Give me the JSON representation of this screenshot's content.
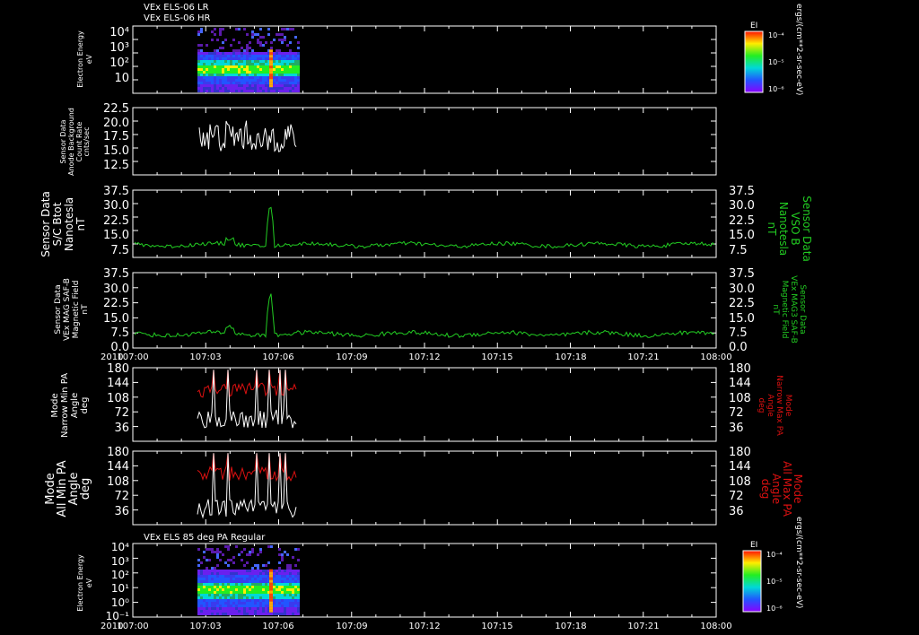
{
  "header": {
    "title_lr": "VEx ELS-06 LR",
    "title_hr": "VEx ELS-06 HR",
    "panel7_title": "VEx ELS 85 deg PA Regular",
    "year": "2010"
  },
  "colors": {
    "background": "#000000",
    "axis": "#ffffff",
    "trace_white": "#ffffff",
    "trace_green": "#22cc22",
    "trace_red": "#dd1111",
    "label_green": "#22cc22",
    "label_red": "#dd1111"
  },
  "time_axis": {
    "labels": [
      "107:00",
      "107:03",
      "107:06",
      "107:09",
      "107:12",
      "107:15",
      "107:18",
      "107:21",
      "108:00"
    ]
  },
  "colorbar": {
    "title": "EI",
    "units": "ergs/(cm**2-sr-sec-eV)",
    "ticks": [
      "10⁻⁴",
      "10⁻⁵",
      "10⁻⁶"
    ]
  },
  "chart_data": [
    {
      "type": "heatmap",
      "id": "p1",
      "ylabel": [
        "Electron Energy",
        "eV"
      ],
      "yticks": [
        "10⁴",
        "10³",
        "10²",
        "10"
      ],
      "coverage": [
        "107:02.5",
        "107:06.2"
      ]
    },
    {
      "type": "line",
      "id": "p2",
      "ylabel": [
        "Sensor Data",
        "Anode Background",
        "Count Rate",
        "cnts/sec"
      ],
      "ylim": [
        10,
        22.5
      ],
      "yticks": [
        "22.5",
        "20.0",
        "17.5",
        "15.0",
        "12.5"
      ],
      "series": [
        {
          "color": "#ffffff",
          "x": [
            107.0417,
            107.1033
          ],
          "y": [
            17.8,
            16.5
          ]
        }
      ]
    },
    {
      "type": "line",
      "id": "p3",
      "ylabel": [
        "Sensor Data",
        "S/C Btot",
        "Nanotesla",
        "nT"
      ],
      "ylabel_right": [
        "Sensor Data",
        "VSO B",
        "Nanotesla",
        "nT"
      ],
      "ylim": [
        0,
        37.5
      ],
      "yticks": [
        "37.5",
        "30.0",
        "22.5",
        "15.0",
        "7.5"
      ],
      "series": [
        {
          "color": "#22cc22",
          "baseline": 7.5,
          "spike_at": 107.0875,
          "spike_peak": 31.5
        }
      ]
    },
    {
      "type": "line",
      "id": "p4",
      "ylabel": [
        "Sensor Data",
        "VEx MAG SAF-B",
        "Magnetic Field",
        "nT"
      ],
      "ylabel_right": [
        "Sensor Data",
        "VEx MAG3 SAF-B",
        "Magnetic Field",
        "nT"
      ],
      "ylim": [
        0,
        37.5
      ],
      "yticks": [
        "37.5",
        "30.0",
        "22.5",
        "15.0",
        "7.5",
        "0.0"
      ],
      "series": [
        {
          "color": "#22cc22",
          "baseline": 7.5,
          "spike_at": 107.0875,
          "spike_peak": 30
        }
      ]
    },
    {
      "type": "line",
      "id": "p5",
      "ylabel": [
        "Mode",
        "Narrow Min PA",
        "Angle",
        "deg"
      ],
      "ylabel_right": [
        "Mode",
        "Narrow Max PA",
        "Angle",
        "deg"
      ],
      "ylim": [
        0,
        180
      ],
      "yticks": [
        "180",
        "144",
        "108",
        "72",
        "36"
      ],
      "series": [
        {
          "name": "min",
          "color": "#ffffff",
          "mean": 55
        },
        {
          "name": "max",
          "color": "#dd1111",
          "mean": 125
        }
      ]
    },
    {
      "type": "line",
      "id": "p6",
      "ylabel": [
        "Mode",
        "All Min PA",
        "Angle",
        "deg"
      ],
      "ylabel_right": [
        "Mode",
        "All Max PA",
        "Angle",
        "deg"
      ],
      "ylim": [
        0,
        180
      ],
      "yticks": [
        "180",
        "144",
        "108",
        "72",
        "36"
      ],
      "series": [
        {
          "name": "min",
          "color": "#ffffff",
          "mean": 40
        },
        {
          "name": "max",
          "color": "#dd1111",
          "mean": 125
        }
      ]
    },
    {
      "type": "heatmap",
      "id": "p7",
      "ylabel": [
        "Electron Energy",
        "eV"
      ],
      "yticks": [
        "10⁴",
        "10³",
        "10²",
        "10¹",
        "10⁰",
        "10⁻¹"
      ],
      "coverage": [
        "107:02.5",
        "107:06.2"
      ]
    }
  ]
}
